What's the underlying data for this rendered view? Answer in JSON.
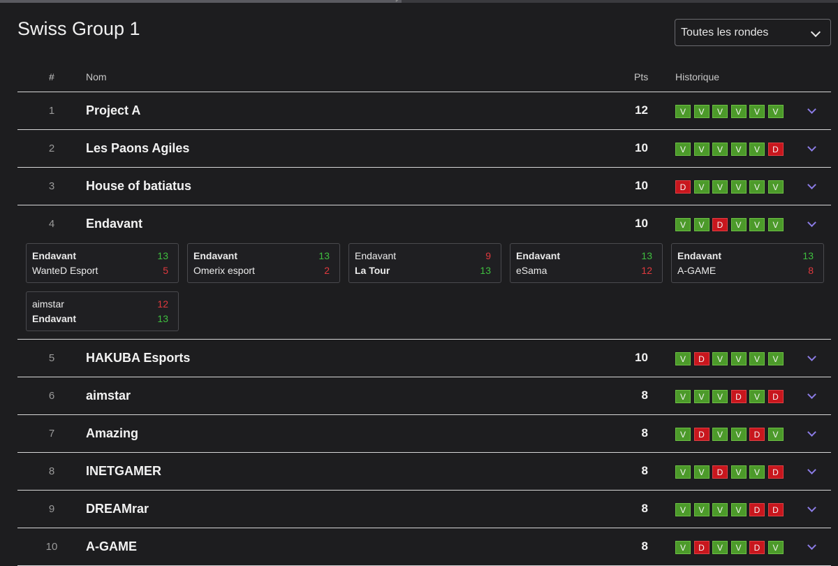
{
  "page": {
    "title": "Swiss Group 1"
  },
  "round_select": {
    "value": "Toutes les rondes"
  },
  "table": {
    "headers": {
      "rank": "#",
      "name": "Nom",
      "points": "Pts",
      "history": "Historique"
    },
    "rows": [
      {
        "rank": "1",
        "name": "Project A",
        "points": "12",
        "history": [
          "V",
          "V",
          "V",
          "V",
          "V",
          "V"
        ]
      },
      {
        "rank": "2",
        "name": "Les Paons Agiles",
        "points": "10",
        "history": [
          "V",
          "V",
          "V",
          "V",
          "V",
          "D"
        ]
      },
      {
        "rank": "3",
        "name": "House of batiatus",
        "points": "10",
        "history": [
          "D",
          "V",
          "V",
          "V",
          "V",
          "V"
        ]
      },
      {
        "rank": "4",
        "name": "Endavant",
        "points": "10",
        "history": [
          "V",
          "V",
          "D",
          "V",
          "V",
          "V"
        ],
        "expanded": true
      },
      {
        "rank": "5",
        "name": "HAKUBA Esports",
        "points": "10",
        "history": [
          "V",
          "D",
          "V",
          "V",
          "V",
          "V"
        ]
      },
      {
        "rank": "6",
        "name": "aimstar",
        "points": "8",
        "history": [
          "V",
          "V",
          "V",
          "D",
          "V",
          "D"
        ]
      },
      {
        "rank": "7",
        "name": "Amazing",
        "points": "8",
        "history": [
          "V",
          "D",
          "V",
          "V",
          "D",
          "V"
        ]
      },
      {
        "rank": "8",
        "name": "INETGAMER",
        "points": "8",
        "history": [
          "V",
          "V",
          "D",
          "V",
          "V",
          "D"
        ]
      },
      {
        "rank": "9",
        "name": "DREAMrar",
        "points": "8",
        "history": [
          "V",
          "V",
          "V",
          "V",
          "D",
          "D"
        ]
      },
      {
        "rank": "10",
        "name": "A-GAME",
        "points": "8",
        "history": [
          "V",
          "D",
          "V",
          "V",
          "D",
          "V"
        ]
      }
    ],
    "expanded_matches": [
      {
        "team1": "Endavant",
        "score1": "13",
        "team2": "WanteD Esport",
        "score2": "5",
        "winner": 1
      },
      {
        "team1": "Endavant",
        "score1": "13",
        "team2": "Omerix esport",
        "score2": "2",
        "winner": 1
      },
      {
        "team1": "Endavant",
        "score1": "9",
        "team2": "La Tour",
        "score2": "13",
        "winner": 2
      },
      {
        "team1": "Endavant",
        "score1": "13",
        "team2": "eSama",
        "score2": "12",
        "winner": 1
      },
      {
        "team1": "Endavant",
        "score1": "13",
        "team2": "A-GAME",
        "score2": "8",
        "winner": 1
      },
      {
        "team1": "aimstar",
        "score1": "12",
        "team2": "Endavant",
        "score2": "13",
        "winner": 2
      }
    ]
  },
  "colors": {
    "win": "#4c9a2a",
    "loss": "#c8161d",
    "accent": "#8c7ce6"
  }
}
